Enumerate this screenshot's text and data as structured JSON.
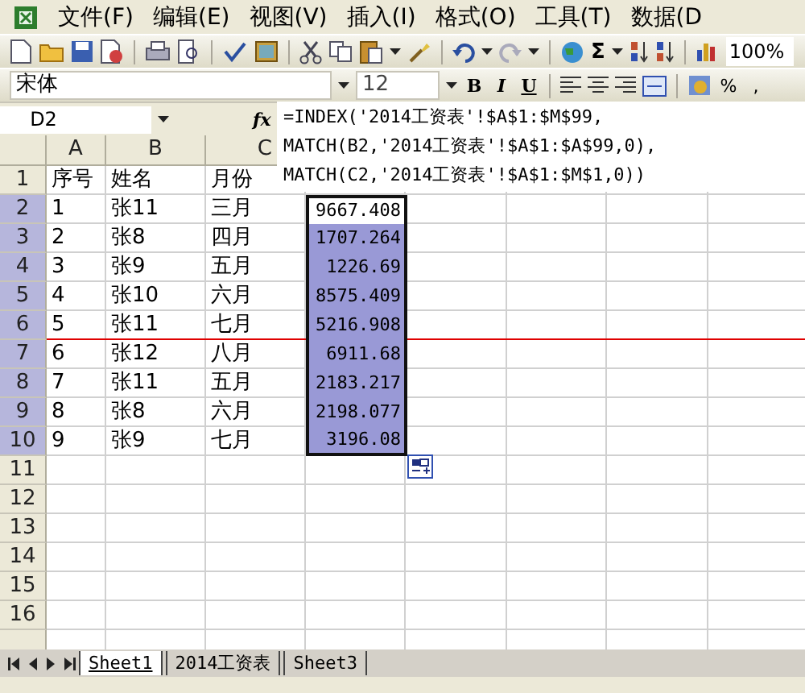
{
  "menu": [
    "文件(F)",
    "编辑(E)",
    "视图(V)",
    "插入(I)",
    "格式(O)",
    "工具(T)",
    "数据(D"
  ],
  "toolbar": {
    "sum": "Σ",
    "zoom": "100%"
  },
  "format_bar": {
    "font": "宋体",
    "size": "12",
    "bold": "B",
    "italic": "I",
    "underline": "U",
    "percent": "%",
    "comma": ","
  },
  "name_box": "D2",
  "function_label": "fx",
  "formula_lines": [
    "=INDEX('2014工资表'!$A$1:$M$99,",
    "MATCH(B2,'2014工资表'!$A$1:$A$99,0),",
    "MATCH(C2,'2014工资表'!$A$1:$M$1,0))"
  ],
  "columns": [
    "A",
    "B",
    "C"
  ],
  "rows": [
    {
      "number": "1",
      "selected": false,
      "red_rule": false,
      "cells": [
        "序号",
        "姓名",
        "月份"
      ]
    },
    {
      "number": "2",
      "selected": true,
      "active": true,
      "red_rule": false,
      "cells": [
        "1",
        "张11",
        "三月",
        "9667.408"
      ]
    },
    {
      "number": "3",
      "selected": true,
      "active": false,
      "red_rule": false,
      "cells": [
        "2",
        "张8",
        "四月",
        "1707.264"
      ]
    },
    {
      "number": "4",
      "selected": true,
      "active": false,
      "red_rule": false,
      "cells": [
        "3",
        "张9",
        "五月",
        "1226.69"
      ]
    },
    {
      "number": "5",
      "selected": true,
      "active": false,
      "red_rule": false,
      "cells": [
        "4",
        "张10",
        "六月",
        "8575.409"
      ]
    },
    {
      "number": "6",
      "selected": true,
      "active": false,
      "red_rule": true,
      "cells": [
        "5",
        "张11",
        "七月",
        "5216.908"
      ]
    },
    {
      "number": "7",
      "selected": true,
      "active": false,
      "red_rule": false,
      "cells": [
        "6",
        "张12",
        "八月",
        "6911.68"
      ]
    },
    {
      "number": "8",
      "selected": true,
      "active": false,
      "red_rule": false,
      "cells": [
        "7",
        "张11",
        "五月",
        "2183.217"
      ]
    },
    {
      "number": "9",
      "selected": true,
      "active": false,
      "red_rule": false,
      "cells": [
        "8",
        "张8",
        "六月",
        "2198.077"
      ]
    },
    {
      "number": "10",
      "selected": true,
      "active": false,
      "red_rule": false,
      "cells": [
        "9",
        "张9",
        "七月",
        "3196.08"
      ]
    },
    {
      "number": "11",
      "selected": false,
      "red_rule": false,
      "cells": []
    },
    {
      "number": "12",
      "selected": false,
      "red_rule": false,
      "cells": []
    },
    {
      "number": "13",
      "selected": false,
      "red_rule": false,
      "cells": []
    },
    {
      "number": "14",
      "selected": false,
      "red_rule": false,
      "cells": []
    },
    {
      "number": "15",
      "selected": false,
      "red_rule": false,
      "cells": []
    },
    {
      "number": "16",
      "selected": false,
      "red_rule": false,
      "cells": []
    }
  ],
  "sheet_tabs": [
    {
      "label": "Sheet1",
      "selected": true
    },
    {
      "label": "2014工资表",
      "selected": false
    },
    {
      "label": "Sheet3",
      "selected": false
    }
  ]
}
